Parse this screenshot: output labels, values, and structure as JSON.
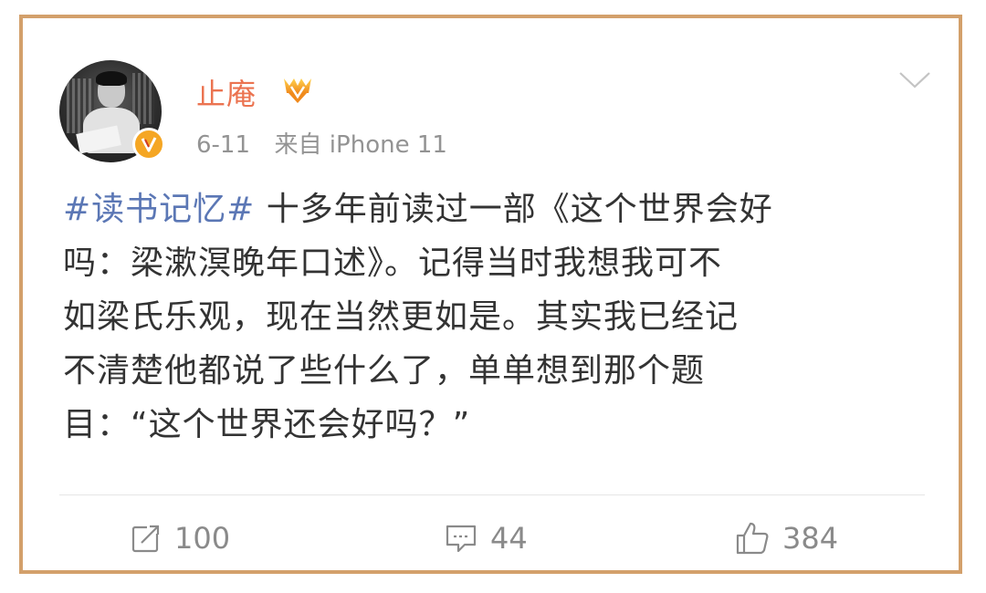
{
  "post": {
    "username": "止庵",
    "date": "6-11",
    "source": "来自 iPhone 11",
    "topic": "#读书记忆#",
    "lines": [
      " 十多年前读过一部《这个世界会好",
      "吗：梁漱溟晚年口述》。记得当时我想我可不",
      "如梁氏乐观，现在当然更如是。其实我已经记",
      "不清楚他都说了些什么了，单单想到那个题",
      "目：“这个世界还会好吗？”"
    ]
  },
  "actions": {
    "repost_count": "100",
    "comment_count": "44",
    "like_count": "384"
  },
  "icons": {
    "member": "vip-member-icon",
    "verified": "verified-v-badge-icon",
    "menu": "chevron-down-icon",
    "repost": "repost-icon",
    "comment": "comment-icon",
    "like": "thumbs-up-icon"
  },
  "colors": {
    "username": "#eb7350",
    "topic": "#5b77b5",
    "frame": "#d3a06b",
    "meta": "#939393"
  }
}
